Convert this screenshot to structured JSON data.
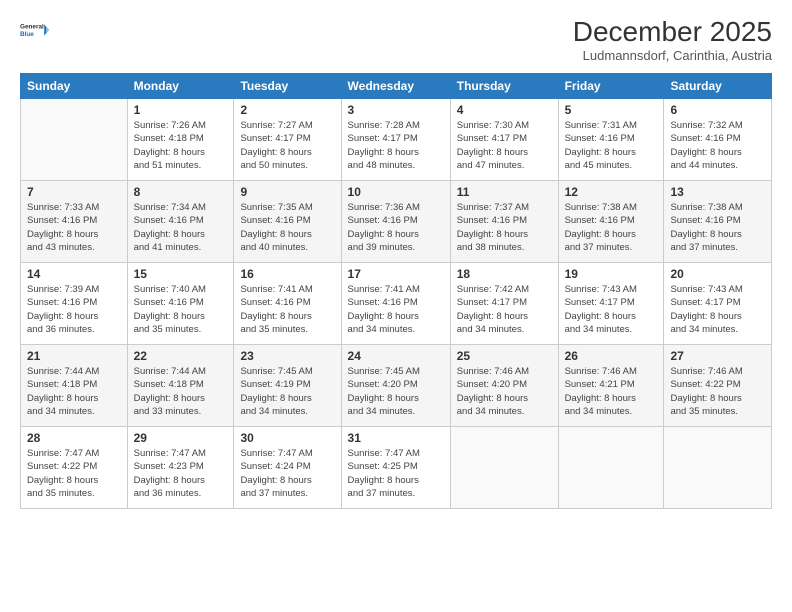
{
  "logo": {
    "line1": "General",
    "line2": "Blue"
  },
  "title": "December 2025",
  "location": "Ludmannsdorf, Carinthia, Austria",
  "days_of_week": [
    "Sunday",
    "Monday",
    "Tuesday",
    "Wednesday",
    "Thursday",
    "Friday",
    "Saturday"
  ],
  "weeks": [
    [
      {
        "day": "",
        "info": ""
      },
      {
        "day": "1",
        "info": "Sunrise: 7:26 AM\nSunset: 4:18 PM\nDaylight: 8 hours\nand 51 minutes."
      },
      {
        "day": "2",
        "info": "Sunrise: 7:27 AM\nSunset: 4:17 PM\nDaylight: 8 hours\nand 50 minutes."
      },
      {
        "day": "3",
        "info": "Sunrise: 7:28 AM\nSunset: 4:17 PM\nDaylight: 8 hours\nand 48 minutes."
      },
      {
        "day": "4",
        "info": "Sunrise: 7:30 AM\nSunset: 4:17 PM\nDaylight: 8 hours\nand 47 minutes."
      },
      {
        "day": "5",
        "info": "Sunrise: 7:31 AM\nSunset: 4:16 PM\nDaylight: 8 hours\nand 45 minutes."
      },
      {
        "day": "6",
        "info": "Sunrise: 7:32 AM\nSunset: 4:16 PM\nDaylight: 8 hours\nand 44 minutes."
      }
    ],
    [
      {
        "day": "7",
        "info": "Sunrise: 7:33 AM\nSunset: 4:16 PM\nDaylight: 8 hours\nand 43 minutes."
      },
      {
        "day": "8",
        "info": "Sunrise: 7:34 AM\nSunset: 4:16 PM\nDaylight: 8 hours\nand 41 minutes."
      },
      {
        "day": "9",
        "info": "Sunrise: 7:35 AM\nSunset: 4:16 PM\nDaylight: 8 hours\nand 40 minutes."
      },
      {
        "day": "10",
        "info": "Sunrise: 7:36 AM\nSunset: 4:16 PM\nDaylight: 8 hours\nand 39 minutes."
      },
      {
        "day": "11",
        "info": "Sunrise: 7:37 AM\nSunset: 4:16 PM\nDaylight: 8 hours\nand 38 minutes."
      },
      {
        "day": "12",
        "info": "Sunrise: 7:38 AM\nSunset: 4:16 PM\nDaylight: 8 hours\nand 37 minutes."
      },
      {
        "day": "13",
        "info": "Sunrise: 7:38 AM\nSunset: 4:16 PM\nDaylight: 8 hours\nand 37 minutes."
      }
    ],
    [
      {
        "day": "14",
        "info": "Sunrise: 7:39 AM\nSunset: 4:16 PM\nDaylight: 8 hours\nand 36 minutes."
      },
      {
        "day": "15",
        "info": "Sunrise: 7:40 AM\nSunset: 4:16 PM\nDaylight: 8 hours\nand 35 minutes."
      },
      {
        "day": "16",
        "info": "Sunrise: 7:41 AM\nSunset: 4:16 PM\nDaylight: 8 hours\nand 35 minutes."
      },
      {
        "day": "17",
        "info": "Sunrise: 7:41 AM\nSunset: 4:16 PM\nDaylight: 8 hours\nand 34 minutes."
      },
      {
        "day": "18",
        "info": "Sunrise: 7:42 AM\nSunset: 4:17 PM\nDaylight: 8 hours\nand 34 minutes."
      },
      {
        "day": "19",
        "info": "Sunrise: 7:43 AM\nSunset: 4:17 PM\nDaylight: 8 hours\nand 34 minutes."
      },
      {
        "day": "20",
        "info": "Sunrise: 7:43 AM\nSunset: 4:17 PM\nDaylight: 8 hours\nand 34 minutes."
      }
    ],
    [
      {
        "day": "21",
        "info": "Sunrise: 7:44 AM\nSunset: 4:18 PM\nDaylight: 8 hours\nand 34 minutes."
      },
      {
        "day": "22",
        "info": "Sunrise: 7:44 AM\nSunset: 4:18 PM\nDaylight: 8 hours\nand 33 minutes."
      },
      {
        "day": "23",
        "info": "Sunrise: 7:45 AM\nSunset: 4:19 PM\nDaylight: 8 hours\nand 34 minutes."
      },
      {
        "day": "24",
        "info": "Sunrise: 7:45 AM\nSunset: 4:20 PM\nDaylight: 8 hours\nand 34 minutes."
      },
      {
        "day": "25",
        "info": "Sunrise: 7:46 AM\nSunset: 4:20 PM\nDaylight: 8 hours\nand 34 minutes."
      },
      {
        "day": "26",
        "info": "Sunrise: 7:46 AM\nSunset: 4:21 PM\nDaylight: 8 hours\nand 34 minutes."
      },
      {
        "day": "27",
        "info": "Sunrise: 7:46 AM\nSunset: 4:22 PM\nDaylight: 8 hours\nand 35 minutes."
      }
    ],
    [
      {
        "day": "28",
        "info": "Sunrise: 7:47 AM\nSunset: 4:22 PM\nDaylight: 8 hours\nand 35 minutes."
      },
      {
        "day": "29",
        "info": "Sunrise: 7:47 AM\nSunset: 4:23 PM\nDaylight: 8 hours\nand 36 minutes."
      },
      {
        "day": "30",
        "info": "Sunrise: 7:47 AM\nSunset: 4:24 PM\nDaylight: 8 hours\nand 37 minutes."
      },
      {
        "day": "31",
        "info": "Sunrise: 7:47 AM\nSunset: 4:25 PM\nDaylight: 8 hours\nand 37 minutes."
      },
      {
        "day": "",
        "info": ""
      },
      {
        "day": "",
        "info": ""
      },
      {
        "day": "",
        "info": ""
      }
    ]
  ]
}
